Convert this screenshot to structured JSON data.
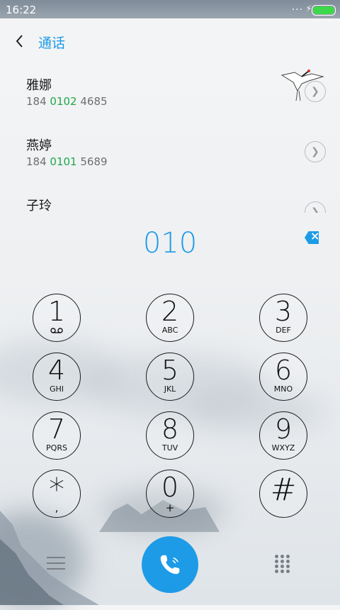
{
  "status_bar": {
    "time": "16:22",
    "dots": "...",
    "bolt": "⚡",
    "battery_level_pct": 100,
    "battery_color": "#3dd84a"
  },
  "header": {
    "title": "通话"
  },
  "contacts": [
    {
      "name": "雅娜",
      "number_prefix": "184 ",
      "number_match": "0102",
      "number_suffix": " 4685"
    },
    {
      "name": "燕婷",
      "number_prefix": "184 ",
      "number_match": "0101",
      "number_suffix": " 5689"
    },
    {
      "name": "子玲",
      "number_prefix": "",
      "number_match": "",
      "number_suffix": ""
    }
  ],
  "dial": {
    "entered": "010"
  },
  "keys": [
    {
      "digit": "1",
      "letters": "",
      "icon": "voicemail-icon"
    },
    {
      "digit": "2",
      "letters": "ABC"
    },
    {
      "digit": "3",
      "letters": "DEF"
    },
    {
      "digit": "4",
      "letters": "GHI"
    },
    {
      "digit": "5",
      "letters": "JKL"
    },
    {
      "digit": "6",
      "letters": "MNO"
    },
    {
      "digit": "7",
      "letters": "PQRS"
    },
    {
      "digit": "8",
      "letters": "TUV"
    },
    {
      "digit": "9",
      "letters": "WXYZ"
    },
    {
      "digit": "*",
      "letters": ","
    },
    {
      "digit": "0",
      "letters": "+"
    },
    {
      "digit": "#",
      "letters": ""
    }
  ],
  "colors": {
    "accent": "#1e9be6",
    "match_highlight": "#1fa84a"
  },
  "icons": {
    "back": "chevron-left-icon",
    "backspace": "backspace-icon",
    "menu": "menu-icon",
    "call": "phone-icon",
    "dialpad": "dialpad-icon"
  }
}
